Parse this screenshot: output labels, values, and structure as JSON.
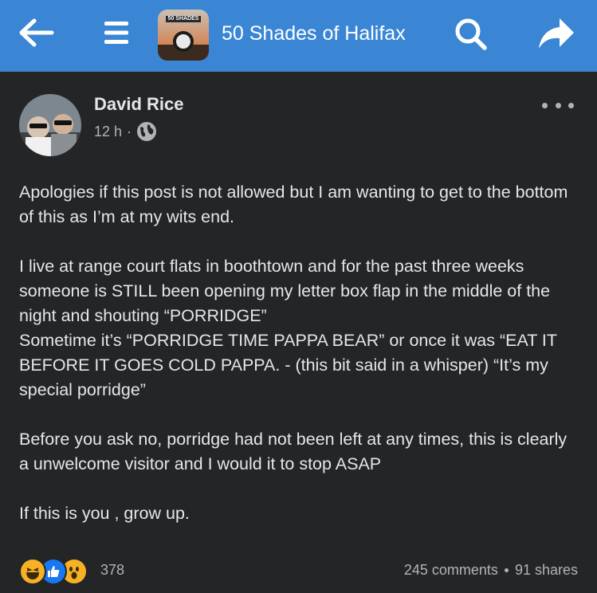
{
  "header": {
    "group_name": "50 Shades of Halifax",
    "thumb_label": "50 SHADES",
    "icons": {
      "back": "back-arrow-icon",
      "menu": "hamburger-menu-icon",
      "search": "search-icon",
      "share": "share-arrow-icon"
    },
    "bar_color": "#3a86d4"
  },
  "post": {
    "author": "David Rice",
    "time": "12 h",
    "sep": "·",
    "privacy_icon": "globe-icon",
    "paragraphs": [
      [
        "Apologies if this post is not allowed but I am wanting to get to the bottom of this as I’m at my wits end."
      ],
      [
        "I live at range court flats in boothtown and for the past three weeks someone is STILL been opening my letter box flap in the middle of the night and shouting “PORRIDGE”",
        "Sometime it’s “PORRIDGE TIME PAPPA BEAR” or once it was “EAT IT BEFORE IT GOES COLD PAPPA. - (this bit said in a whisper) “It’s my special porridge”"
      ],
      [
        "Before you ask no, porridge had not been left at any times, this is clearly a unwelcome visitor and I would it to stop ASAP"
      ],
      [
        "If this is you , grow up."
      ]
    ]
  },
  "footer": {
    "reaction_count": "378",
    "comments": "245 comments",
    "shares": "91 shares",
    "reactions": [
      "haha-icon",
      "like-icon",
      "wow-icon"
    ]
  }
}
